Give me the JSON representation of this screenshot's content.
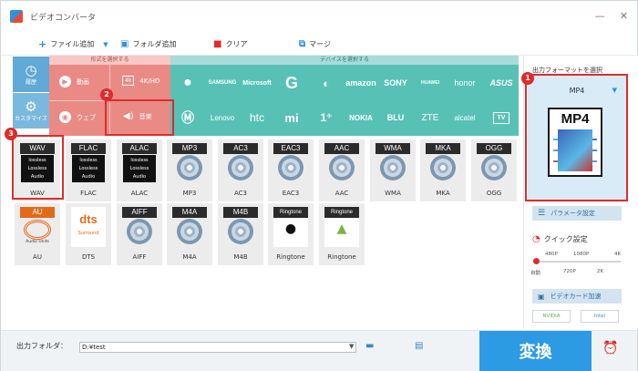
{
  "window": {
    "title": "ビデオコンバータ",
    "controls": [
      "minimize-icon",
      "close-icon"
    ]
  },
  "toolbar": {
    "add_file": "ファイル追加",
    "add_folder": "フォルダ追加",
    "clear": "クリア",
    "merge": "マージ"
  },
  "selector": {
    "format_header": "形式を選択する",
    "device_header": "デバイスを選択する"
  },
  "categories": [
    {
      "label": "履歴"
    },
    {
      "label": "カスタマイズ"
    }
  ],
  "formats": [
    {
      "label": "動画"
    },
    {
      "label": "4K/HD"
    },
    {
      "label": "ウェブ"
    },
    {
      "label": "音楽"
    }
  ],
  "devices": [
    "Apple",
    "SAMSUNG",
    "Microsoft",
    "Google",
    "LG",
    "amazon",
    "SONY",
    "HUAWEI",
    "honor",
    "ASUS",
    "Motorola",
    "Lenovo",
    "htc",
    "mi",
    "OnePlus",
    "NOKIA",
    "BLU",
    "ZTE",
    "alcatel",
    "TV"
  ],
  "audio_formats": [
    "WAV",
    "FLAC",
    "ALAC",
    "MP3",
    "AC3",
    "EAC3",
    "AAC",
    "WMA",
    "MKA",
    "OGG",
    "AU",
    "DTS",
    "AIFF",
    "M4A",
    "M4B",
    "Ringtone",
    "Ringtone"
  ],
  "audio_badges": [
    "WAV",
    "FLAC",
    "ALAC",
    "MP3",
    "AC3",
    "EAC3",
    "AAC",
    "WMA",
    "MKA",
    "OGG",
    "AU",
    "dts",
    "AIFF",
    "M4A",
    "M4B",
    "Ringtone",
    "Ringtone"
  ],
  "lossless": {
    "line1": "lossless",
    "line2": "Lossless",
    "line3": "Audio"
  },
  "au_sub": "Audio Units",
  "dts_sub": "Surround",
  "steps": [
    "1",
    "2",
    "3"
  ],
  "output": {
    "label": "出力フォーマットを選択",
    "format": "MP4",
    "icon_text": "MP4"
  },
  "right": {
    "param_btn": "パラメータ設定",
    "quick": "クイック設定",
    "slider_top": [
      "480P",
      "1080P",
      "4K"
    ],
    "slider_bottom": [
      "自動",
      "720P",
      "2K"
    ],
    "gpu_btn": "ビデオカード加速",
    "nvidia": "NVIDIA",
    "intel": "Intel"
  },
  "bottom": {
    "folder_label": "出力フォルダ：",
    "folder_value": "D:¥test",
    "convert": "変換"
  }
}
